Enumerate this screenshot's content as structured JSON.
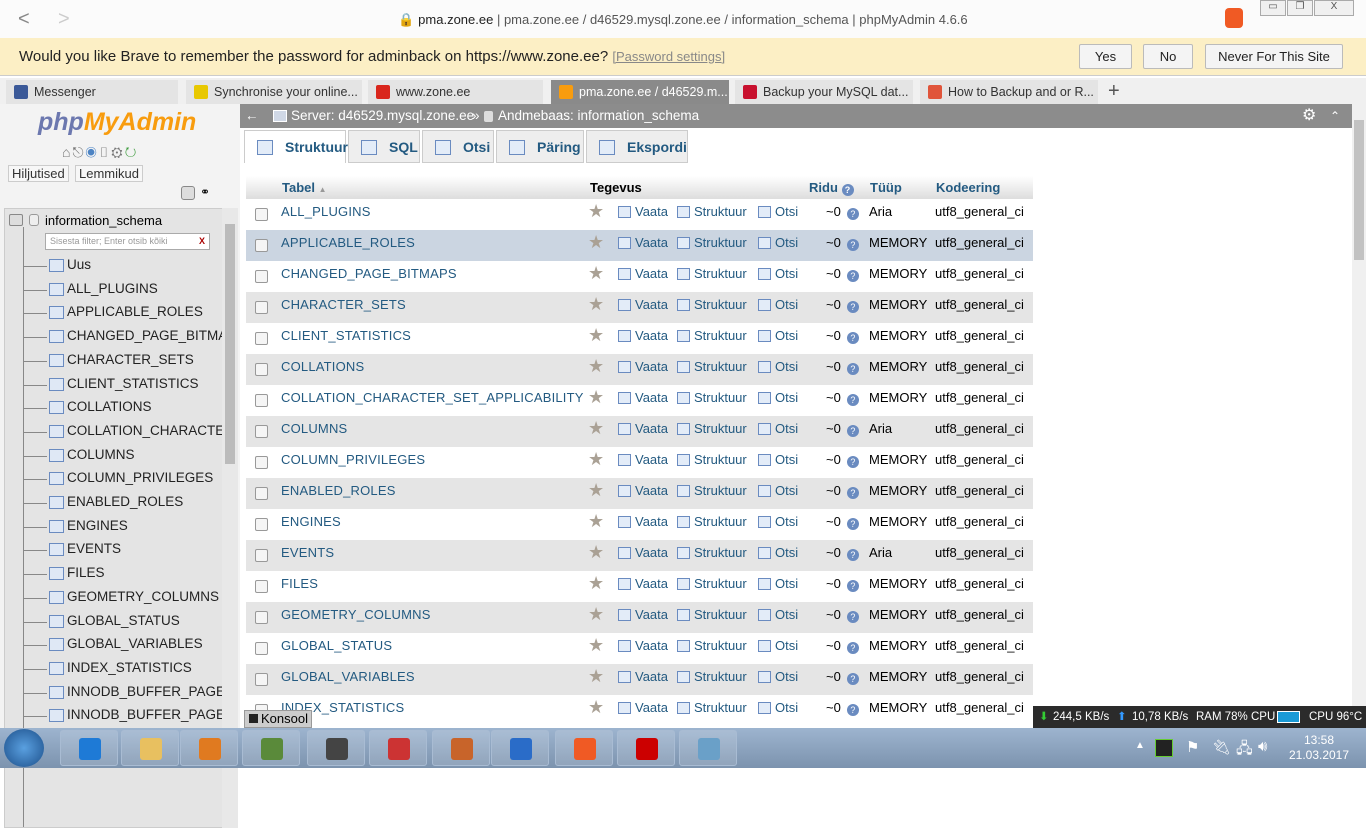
{
  "browser": {
    "title_host": "pma.zone.ee",
    "title_rest": " | pma.zone.ee / d46529.mysql.zone.ee / information_schema | phpMyAdmin 4.6.6",
    "password_bar": {
      "message": "Would you like Brave to remember the password for adminback on https://www.zone.ee?",
      "link": "[Password settings]",
      "yes": "Yes",
      "no": "No",
      "never": "Never For This Site"
    },
    "tabs": [
      {
        "label": "Messenger",
        "color": "#3b5998"
      },
      {
        "label": "Synchronise your online...",
        "color": "#e8c800"
      },
      {
        "label": "www.zone.ee",
        "color": "#d9261c"
      },
      {
        "label": "pma.zone.ee / d46529.m...",
        "color": "#f89c0e",
        "active": true
      },
      {
        "label": "Backup your MySQL dat...",
        "color": "#c8102e"
      },
      {
        "label": "How to Backup and or R...",
        "color": "#e0543a"
      }
    ],
    "new_tab": "+"
  },
  "sidebar": {
    "logo_php": "php",
    "logo_ma": "MyAdmin",
    "recent": "Hiljutised",
    "favorites": "Lemmikud",
    "database": "information_schema",
    "filter_placeholder": "Sisesta filter; Enter otsib kõiki",
    "filter_clear": "X",
    "items": [
      "Uus",
      "ALL_PLUGINS",
      "APPLICABLE_ROLES",
      "CHANGED_PAGE_BITMA",
      "CHARACTER_SETS",
      "CLIENT_STATISTICS",
      "COLLATIONS",
      "COLLATION_CHARACTER",
      "COLUMNS",
      "COLUMN_PRIVILEGES",
      "ENABLED_ROLES",
      "ENGINES",
      "EVENTS",
      "FILES",
      "GEOMETRY_COLUMNS",
      "GLOBAL_STATUS",
      "GLOBAL_VARIABLES",
      "INDEX_STATISTICS",
      "INNODB_BUFFER_PAGE",
      "INNODB_BUFFER_PAGE_"
    ]
  },
  "breadcrumb": {
    "server": "Server: d46529.mysql.zone.ee",
    "sep": "»",
    "database": "Andmebaas: information_schema"
  },
  "tabs": [
    "Struktuur",
    "SQL",
    "Otsi",
    "Päring",
    "Ekspordi"
  ],
  "table": {
    "headers": {
      "name": "Tabel",
      "sort": "▲",
      "action": "Tegevus",
      "rows": "Ridu",
      "type": "Tüüp",
      "collation": "Kodeering"
    },
    "actions": {
      "browse": "Vaata",
      "structure": "Struktuur",
      "search": "Otsi"
    },
    "rows": [
      {
        "name": "ALL_PLUGINS",
        "rows": "~0",
        "type": "Aria",
        "collation": "utf8_general_ci"
      },
      {
        "name": "APPLICABLE_ROLES",
        "rows": "~0",
        "type": "MEMORY",
        "collation": "utf8_general_ci"
      },
      {
        "name": "CHANGED_PAGE_BITMAPS",
        "rows": "~0",
        "type": "MEMORY",
        "collation": "utf8_general_ci"
      },
      {
        "name": "CHARACTER_SETS",
        "rows": "~0",
        "type": "MEMORY",
        "collation": "utf8_general_ci"
      },
      {
        "name": "CLIENT_STATISTICS",
        "rows": "~0",
        "type": "MEMORY",
        "collation": "utf8_general_ci"
      },
      {
        "name": "COLLATIONS",
        "rows": "~0",
        "type": "MEMORY",
        "collation": "utf8_general_ci"
      },
      {
        "name": "COLLATION_CHARACTER_SET_APPLICABILITY",
        "rows": "~0",
        "type": "MEMORY",
        "collation": "utf8_general_ci"
      },
      {
        "name": "COLUMNS",
        "rows": "~0",
        "type": "Aria",
        "collation": "utf8_general_ci"
      },
      {
        "name": "COLUMN_PRIVILEGES",
        "rows": "~0",
        "type": "MEMORY",
        "collation": "utf8_general_ci"
      },
      {
        "name": "ENABLED_ROLES",
        "rows": "~0",
        "type": "MEMORY",
        "collation": "utf8_general_ci"
      },
      {
        "name": "ENGINES",
        "rows": "~0",
        "type": "MEMORY",
        "collation": "utf8_general_ci"
      },
      {
        "name": "EVENTS",
        "rows": "~0",
        "type": "Aria",
        "collation": "utf8_general_ci"
      },
      {
        "name": "FILES",
        "rows": "~0",
        "type": "MEMORY",
        "collation": "utf8_general_ci"
      },
      {
        "name": "GEOMETRY_COLUMNS",
        "rows": "~0",
        "type": "MEMORY",
        "collation": "utf8_general_ci"
      },
      {
        "name": "GLOBAL_STATUS",
        "rows": "~0",
        "type": "MEMORY",
        "collation": "utf8_general_ci"
      },
      {
        "name": "GLOBAL_VARIABLES",
        "rows": "~0",
        "type": "MEMORY",
        "collation": "utf8_general_ci"
      },
      {
        "name": "INDEX_STATISTICS",
        "rows": "~0",
        "type": "MEMORY",
        "collation": "utf8_general_ci"
      }
    ]
  },
  "console": "Konsool",
  "netbar": {
    "down": "244,5 KB/s",
    "up": "10,78 KB/s",
    "ram": "RAM 78%",
    "cpu": "CPU",
    "temp": "CPU 96°C"
  },
  "clock": {
    "time": "13:58",
    "date": "21.03.2017"
  }
}
